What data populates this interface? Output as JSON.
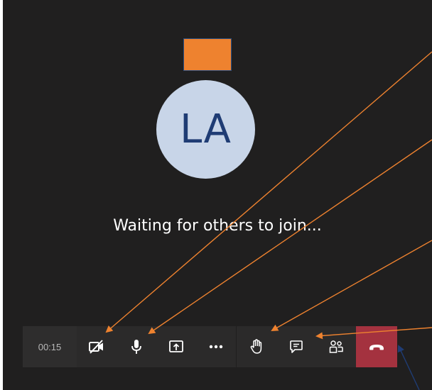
{
  "call": {
    "avatar_initials": "LA",
    "status_text": "Waiting for others to join...",
    "timer": "00:15"
  },
  "toolbar": {
    "buttons": [
      {
        "icon": "camera-off-icon"
      },
      {
        "icon": "microphone-icon"
      },
      {
        "icon": "share-screen-icon"
      },
      {
        "icon": "more-options-icon"
      },
      {
        "icon": "raise-hand-icon"
      },
      {
        "icon": "chat-icon"
      },
      {
        "icon": "participants-icon"
      },
      {
        "icon": "hang-up-icon"
      }
    ]
  },
  "colors": {
    "background": "#201f1f",
    "badge": "#ee822f",
    "avatar_bg": "#c8d5e8",
    "avatar_text": "#1f3c74",
    "hangup": "#a4323f",
    "annotation_arrow": "#ee822f"
  }
}
